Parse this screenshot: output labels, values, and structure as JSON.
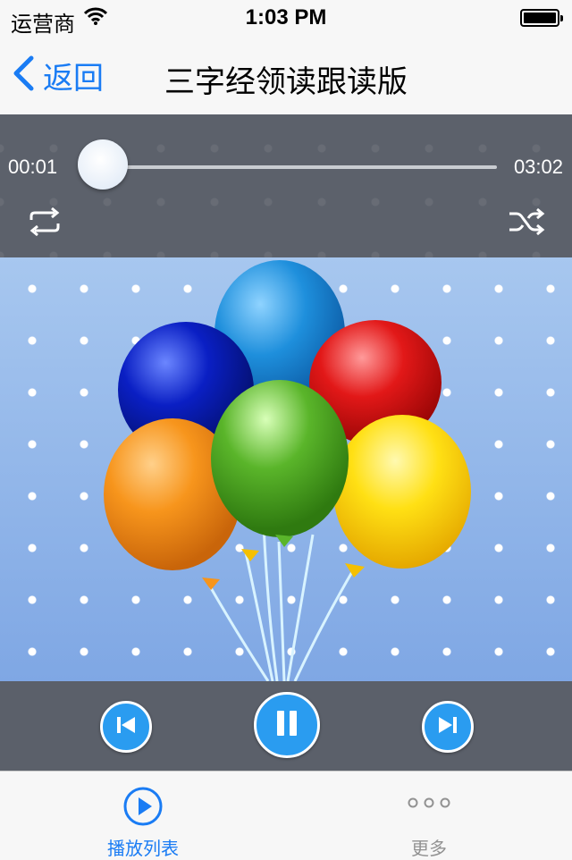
{
  "status_bar": {
    "carrier": "运营商",
    "time": "1:03 PM",
    "battery_level": 1.0
  },
  "nav": {
    "back_label": "返回",
    "title": "三字经领读跟读版"
  },
  "player": {
    "current_time": "00:01",
    "total_time": "03:02",
    "progress": 0.005,
    "is_playing": true
  },
  "artwork": {
    "description_icon": "balloons-illustration"
  },
  "tabs": [
    {
      "label": "播放列表",
      "icon": "play-circle-icon",
      "selected": true
    },
    {
      "label": "更多",
      "icon": "more-dots-icon",
      "selected": false
    }
  ],
  "colors": {
    "accent": "#1a7cf4",
    "player_bg": "#5c616b",
    "button_blue": "#2a9cf0"
  }
}
